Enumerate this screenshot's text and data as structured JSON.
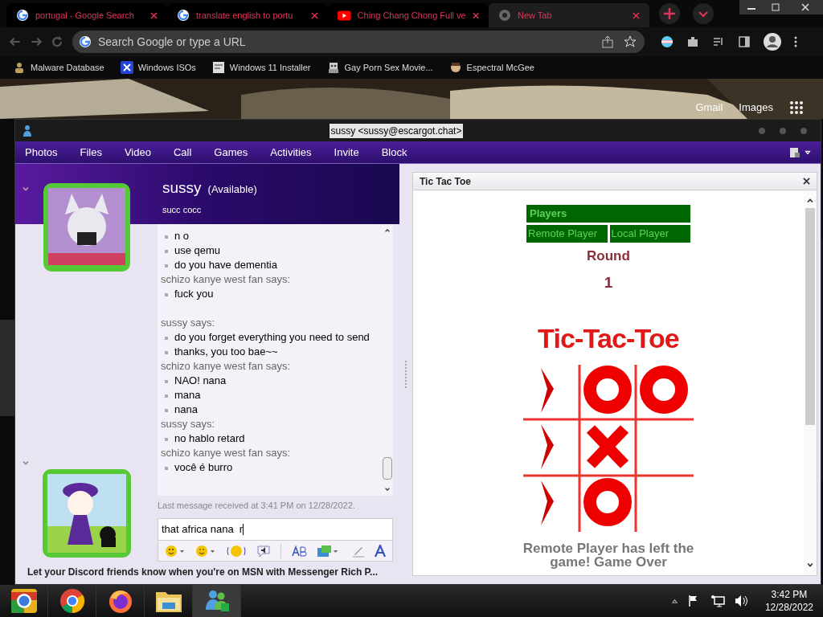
{
  "browser": {
    "tabs": [
      {
        "title": "portugal - Google Search",
        "kind": "google",
        "selected": false
      },
      {
        "title": "translate english to portu",
        "kind": "google",
        "selected": false
      },
      {
        "title": "Ching Chang Chong Full ve",
        "kind": "youtube",
        "selected": false
      },
      {
        "title": "New Tab",
        "kind": "chrome",
        "selected": true
      }
    ],
    "address": {
      "placeholder": "Search Google or type a URL"
    },
    "bookmarks": [
      {
        "label": "Malware Database",
        "kind": "person"
      },
      {
        "label": "Windows ISOs",
        "kind": "x"
      },
      {
        "label": "Windows 11 Installer",
        "kind": "page"
      },
      {
        "label": "Gay Porn Sex Movie...",
        "kind": "robot"
      },
      {
        "label": "Espectral McGee",
        "kind": "face"
      }
    ],
    "page_links": [
      "Gmail",
      "Images"
    ]
  },
  "messenger": {
    "title": "sussy <sussy@escargot.chat>",
    "menu": [
      "Photos",
      "Files",
      "Video",
      "Call",
      "Games",
      "Activities",
      "Invite",
      "Block"
    ],
    "contact": {
      "name": "sussy",
      "status": "(Available)",
      "message": "succ cocc"
    },
    "conversation": [
      {
        "lines": [
          "n o",
          "use qemu",
          "do you have dementia"
        ]
      },
      {
        "sender": "schizo kanye west fan says:",
        "lines": [
          "fuck you"
        ]
      },
      {
        "sender": "sussy says:",
        "lines": [
          "do you forget everything you need to send",
          "thanks, you too bae~~"
        ]
      },
      {
        "sender": "schizo kanye west fan says:",
        "lines": [
          "NAO! nana",
          "mana",
          "nana"
        ]
      },
      {
        "sender": "sussy says:",
        "lines": [
          "no hablo retard"
        ]
      },
      {
        "sender": "schizo kanye west fan says:",
        "lines": [
          "você é burro"
        ]
      }
    ],
    "last_message": "Last message received at 3:41 PM on 12/28/2022.",
    "input": {
      "value": "that africa nana  r"
    },
    "footer": "Let your Discord friends know when you're on MSN with Messenger Rich P...",
    "game": {
      "title": "Tic Tac Toe",
      "players_heading": "Players",
      "players": [
        "Remote Player",
        "Local Player"
      ],
      "round_label": "Round",
      "round": "1",
      "logo": "Tic-Tac-Toe",
      "board": [
        {
          "kind": "cut"
        },
        {
          "kind": "o"
        },
        {
          "kind": "o"
        },
        {
          "kind": "cut"
        },
        {
          "kind": "x"
        },
        {
          "kind": "empty"
        },
        {
          "kind": "cut"
        },
        {
          "kind": "o"
        },
        {
          "kind": "empty"
        }
      ],
      "message": "Remote Player has left the game! Game Over"
    }
  },
  "taskbar": {
    "apps": [
      {
        "kind": "canary",
        "selected": false
      },
      {
        "kind": "chrome",
        "selected": false
      },
      {
        "kind": "firefox",
        "selected": false
      },
      {
        "kind": "folder",
        "selected": false
      },
      {
        "kind": "messenger",
        "selected": true
      }
    ],
    "time": "3:42 PM",
    "date": "12/28/2022"
  }
}
